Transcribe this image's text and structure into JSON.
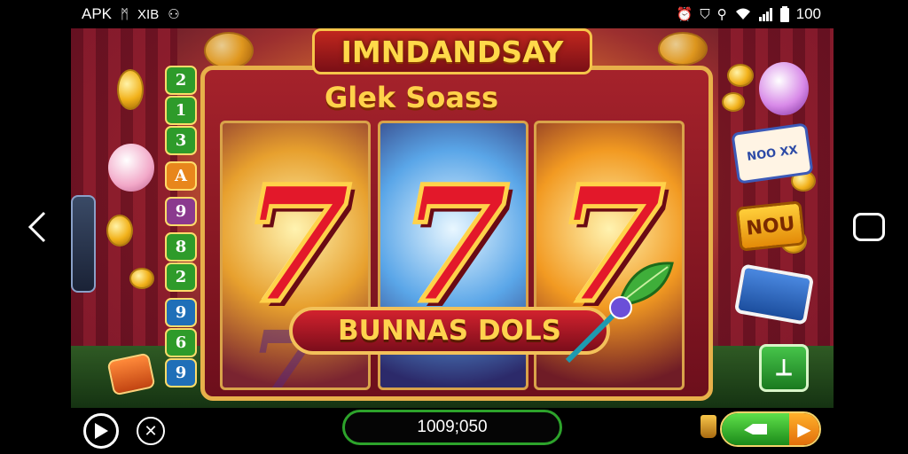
{
  "status_bar": {
    "left_items": [
      "APK",
      "ᛗ",
      "XIB",
      "⚇"
    ],
    "battery": "100"
  },
  "game": {
    "title": "IMNDANDSAY",
    "subtitle": "Glek Soass",
    "bonus_label": "BUNNAS DOLS",
    "reel_symbols": [
      "7",
      "7",
      "7"
    ],
    "faint_symbols": [
      "7",
      "",
      ""
    ],
    "payline_numbers": [
      {
        "label": "2",
        "color": "#2e9b2a"
      },
      {
        "label": "1",
        "color": "#2e9b2a"
      },
      {
        "label": "3",
        "color": "#2e9b2a"
      },
      {
        "label": "A",
        "color": "#e8861c"
      },
      {
        "label": "9",
        "color": "#8b3a8e"
      },
      {
        "label": "8",
        "color": "#2e9b2a"
      },
      {
        "label": "2",
        "color": "#2e9b2a"
      },
      {
        "label": "9",
        "color": "#1f6fb8"
      },
      {
        "label": "6",
        "color": "#2e9b2a"
      },
      {
        "label": "9",
        "color": "#1f6fb8"
      }
    ],
    "deco_card_top": "NOO XX",
    "deco_card_mid": "NOU"
  },
  "bottom_bar": {
    "balance": "1009;050",
    "spin_arrow": "▶"
  },
  "colors": {
    "accent_gold": "#ffd24a",
    "accent_red": "#c0271e",
    "spin_green": "#2ec32a"
  }
}
